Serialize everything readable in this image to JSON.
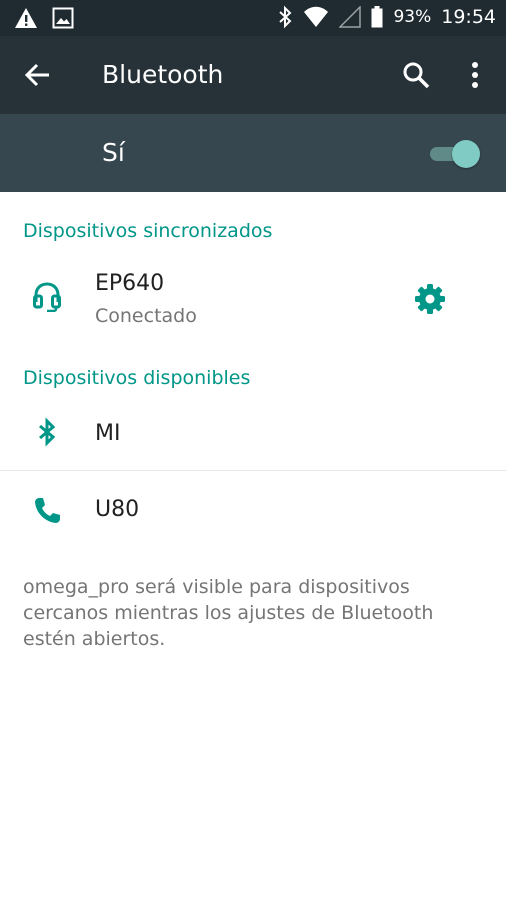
{
  "status_bar": {
    "battery": "93%",
    "time": "19:54",
    "icons": [
      "warning-icon",
      "image-icon",
      "bluetooth-icon",
      "wifi-icon",
      "signal-icon",
      "battery-icon"
    ]
  },
  "toolbar": {
    "title": "Bluetooth",
    "icons": [
      "back-arrow-icon",
      "search-icon",
      "more-vert-icon"
    ]
  },
  "master_switch": {
    "label": "Sí",
    "on": true
  },
  "paired": {
    "header": "Dispositivos sincronizados",
    "devices": [
      {
        "name": "EP640",
        "status": "Conectado",
        "icon": "headset-icon"
      }
    ]
  },
  "available": {
    "header": "Dispositivos disponibles",
    "devices": [
      {
        "name": "MI",
        "icon": "bluetooth-icon"
      },
      {
        "name": "U80",
        "icon": "phone-icon"
      }
    ]
  },
  "footer": {
    "text": "omega_pro será visible para dispositivos cercanos mientras los ajustes de Bluetooth estén abiertos."
  },
  "colors": {
    "accent": "#009688",
    "toolbar": "#263238",
    "switch_bar": "#37474f",
    "status_bar": "#1f2b30"
  }
}
